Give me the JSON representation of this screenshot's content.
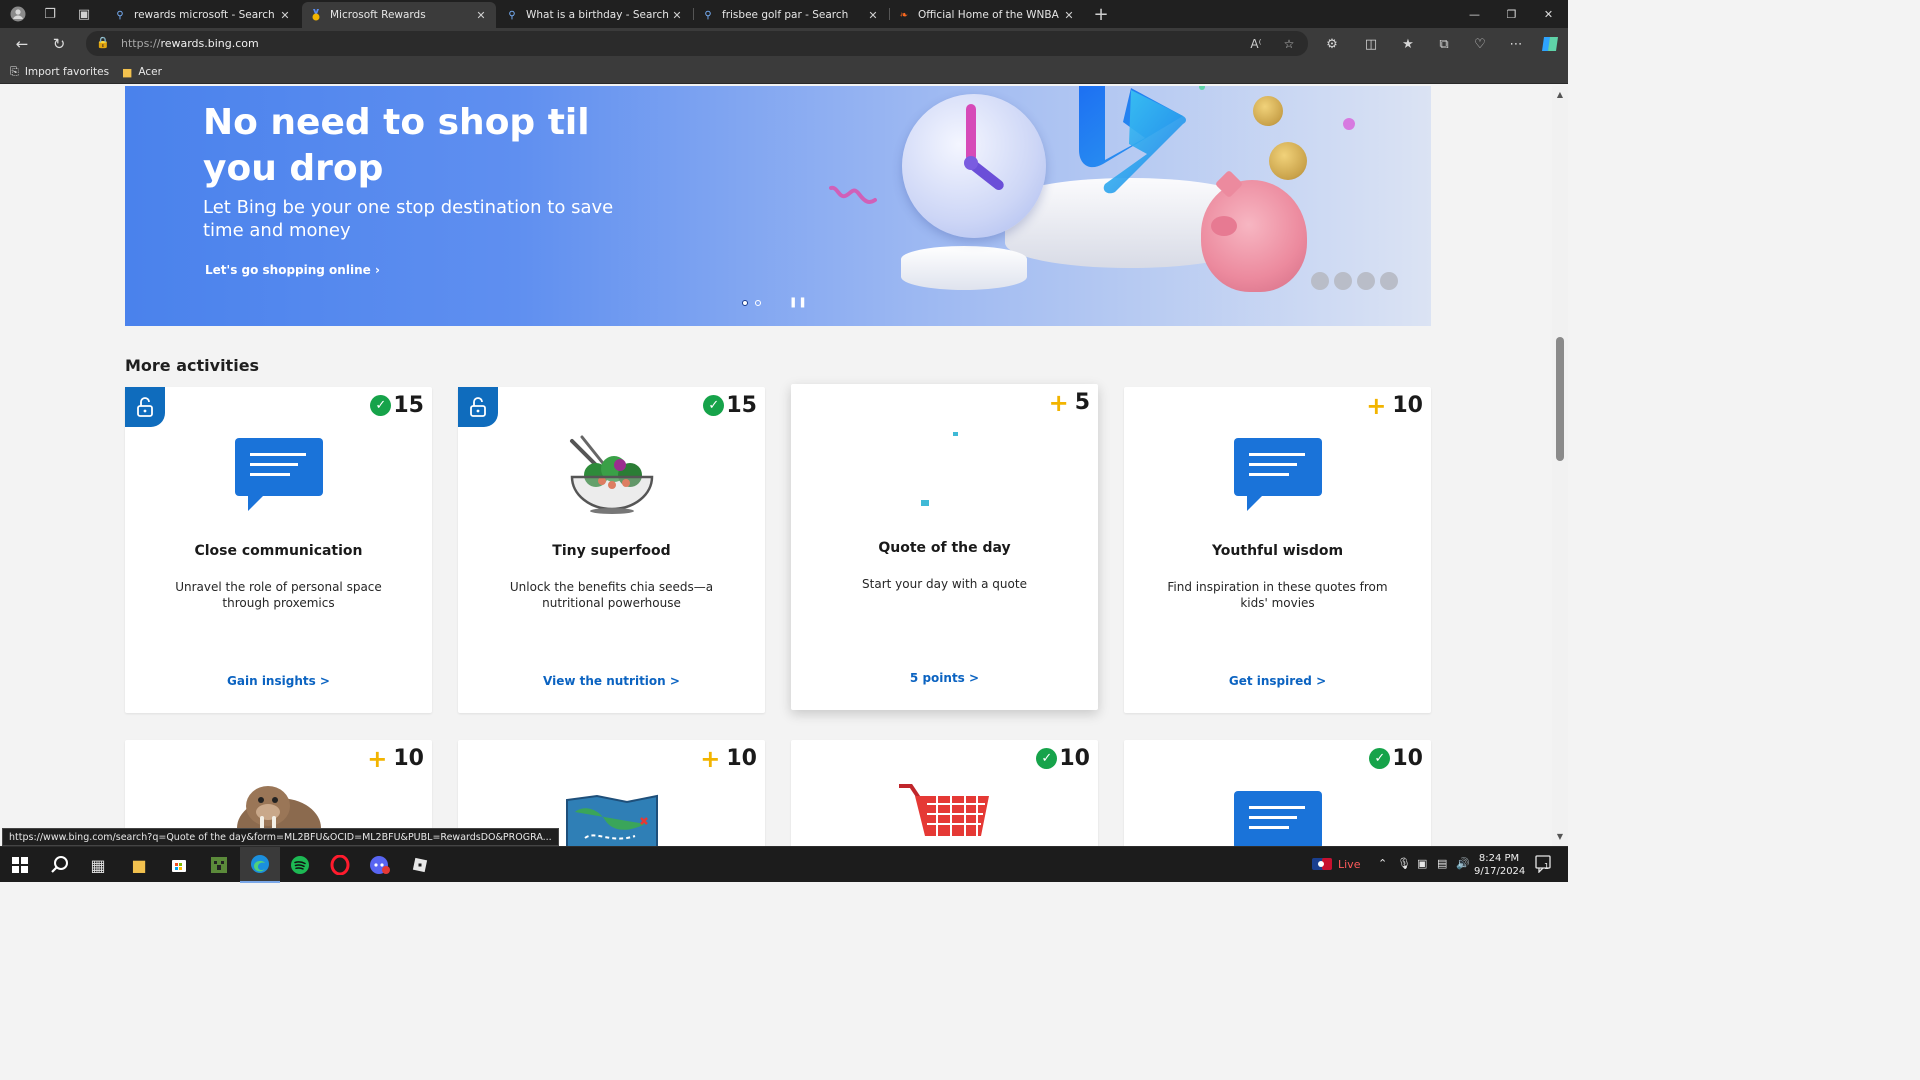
{
  "browser": {
    "tabs": [
      {
        "title": "rewards microsoft - Search",
        "favicon": "search-icon",
        "active": false
      },
      {
        "title": "Microsoft Rewards",
        "favicon": "rewards-medal-icon",
        "active": true
      },
      {
        "title": "What is a birthday - Search",
        "favicon": "search-icon",
        "active": false
      },
      {
        "title": "frisbee golf par - Search",
        "favicon": "search-icon",
        "active": false
      },
      {
        "title": "Official Home of the WNBA | Won",
        "favicon": "wnba-icon",
        "active": false
      }
    ],
    "url_prefix": "https://",
    "url_host": "rewards.bing.com",
    "favorites": [
      {
        "label": "Import favorites",
        "icon": "import-icon"
      },
      {
        "label": "Acer",
        "icon": "folder-icon"
      }
    ]
  },
  "hero": {
    "title": "No need to shop til you drop",
    "subtitle": "Let Bing be your one stop destination to save time and money",
    "link": "Let's go shopping online",
    "slide_index": 1,
    "slide_count": 2
  },
  "activities": {
    "section_title": "More activities",
    "cards": [
      {
        "title": "Close communication",
        "description": "Unravel the role of personal space through proxemics",
        "link": "Gain insights >",
        "points": "15",
        "completed": true,
        "locked": true,
        "icon": "chat-bubble-icon"
      },
      {
        "title": "Tiny superfood",
        "description": "Unlock the benefits chia seeds—a nutritional powerhouse",
        "link": "View the nutrition >",
        "points": "15",
        "completed": true,
        "locked": true,
        "icon": "salad-bowl-icon"
      },
      {
        "title": "Quote of the day",
        "description": "Start your day with a quote",
        "link": "5 points >",
        "points": "5",
        "completed": false,
        "locked": false,
        "icon": "loading-icon"
      },
      {
        "title": "Youthful wisdom",
        "description": "Find inspiration in these quotes from kids' movies",
        "link": "Get inspired >",
        "points": "10",
        "completed": false,
        "locked": false,
        "icon": "chat-bubble-icon"
      }
    ],
    "cards_row2": [
      {
        "points": "10",
        "completed": false,
        "icon": "walrus-icon"
      },
      {
        "points": "10",
        "completed": false,
        "icon": "map-icon"
      },
      {
        "points": "10",
        "completed": true,
        "icon": "shopping-cart-icon"
      },
      {
        "points": "10",
        "completed": true,
        "icon": "chat-bubble-icon"
      }
    ]
  },
  "status_bar_url": "https://www.bing.com/search?q=Quote of the day&form=ML2BFU&OCID=ML2BFU&PUBL=RewardsDO&PROGRA...",
  "taskbar": {
    "live_label": "Live",
    "time": "8:24 PM",
    "date": "9/17/2024",
    "notification_count": "1"
  },
  "colors": {
    "accent": "#0f6cbd",
    "link": "#0b63c1",
    "check": "#16a34a",
    "plus": "#f2b400"
  }
}
